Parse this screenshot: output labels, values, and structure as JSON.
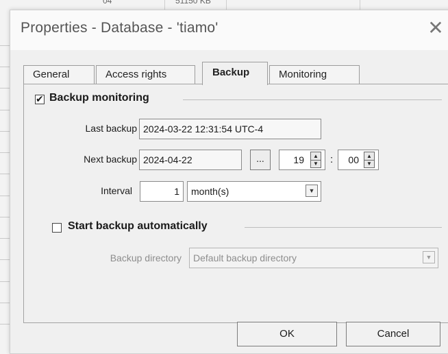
{
  "window": {
    "title": "Properties - Database - 'tiamo'",
    "close_glyph": "✕"
  },
  "background": {
    "snippet_a": "04",
    "snippet_b": "51150 KB"
  },
  "tabs": [
    {
      "label": "General",
      "active": false
    },
    {
      "label": "Access rights",
      "active": false
    },
    {
      "label": "Backup",
      "active": true
    },
    {
      "label": "Monitoring",
      "active": false
    }
  ],
  "backup": {
    "monitoring_label": "Backup monitoring",
    "monitoring_checked": true,
    "last_backup_label": "Last backup",
    "last_backup_value": "2024-03-22 12:31:54 UTC-4",
    "next_backup_label": "Next backup",
    "next_backup_date": "2024-04-22",
    "date_picker_label": "...",
    "hour": "19",
    "time_separator": ":",
    "minute": "00",
    "interval_label": "Interval",
    "interval_value": "1",
    "interval_unit": "month(s)",
    "auto_label": "Start backup automatically",
    "auto_checked": false,
    "directory_label": "Backup directory",
    "directory_value": "Default backup directory"
  },
  "buttons": {
    "ok": "OK",
    "cancel": "Cancel"
  },
  "icons": {
    "close": "close-icon",
    "spin": "spin-up-down-icon",
    "dropdown": "chevron-down-icon",
    "checkbox": "checkmark-icon"
  },
  "colors": {
    "window_bg": "#f0f0f0",
    "title_text": "#555555",
    "disabled_text": "#8d8d8d"
  }
}
